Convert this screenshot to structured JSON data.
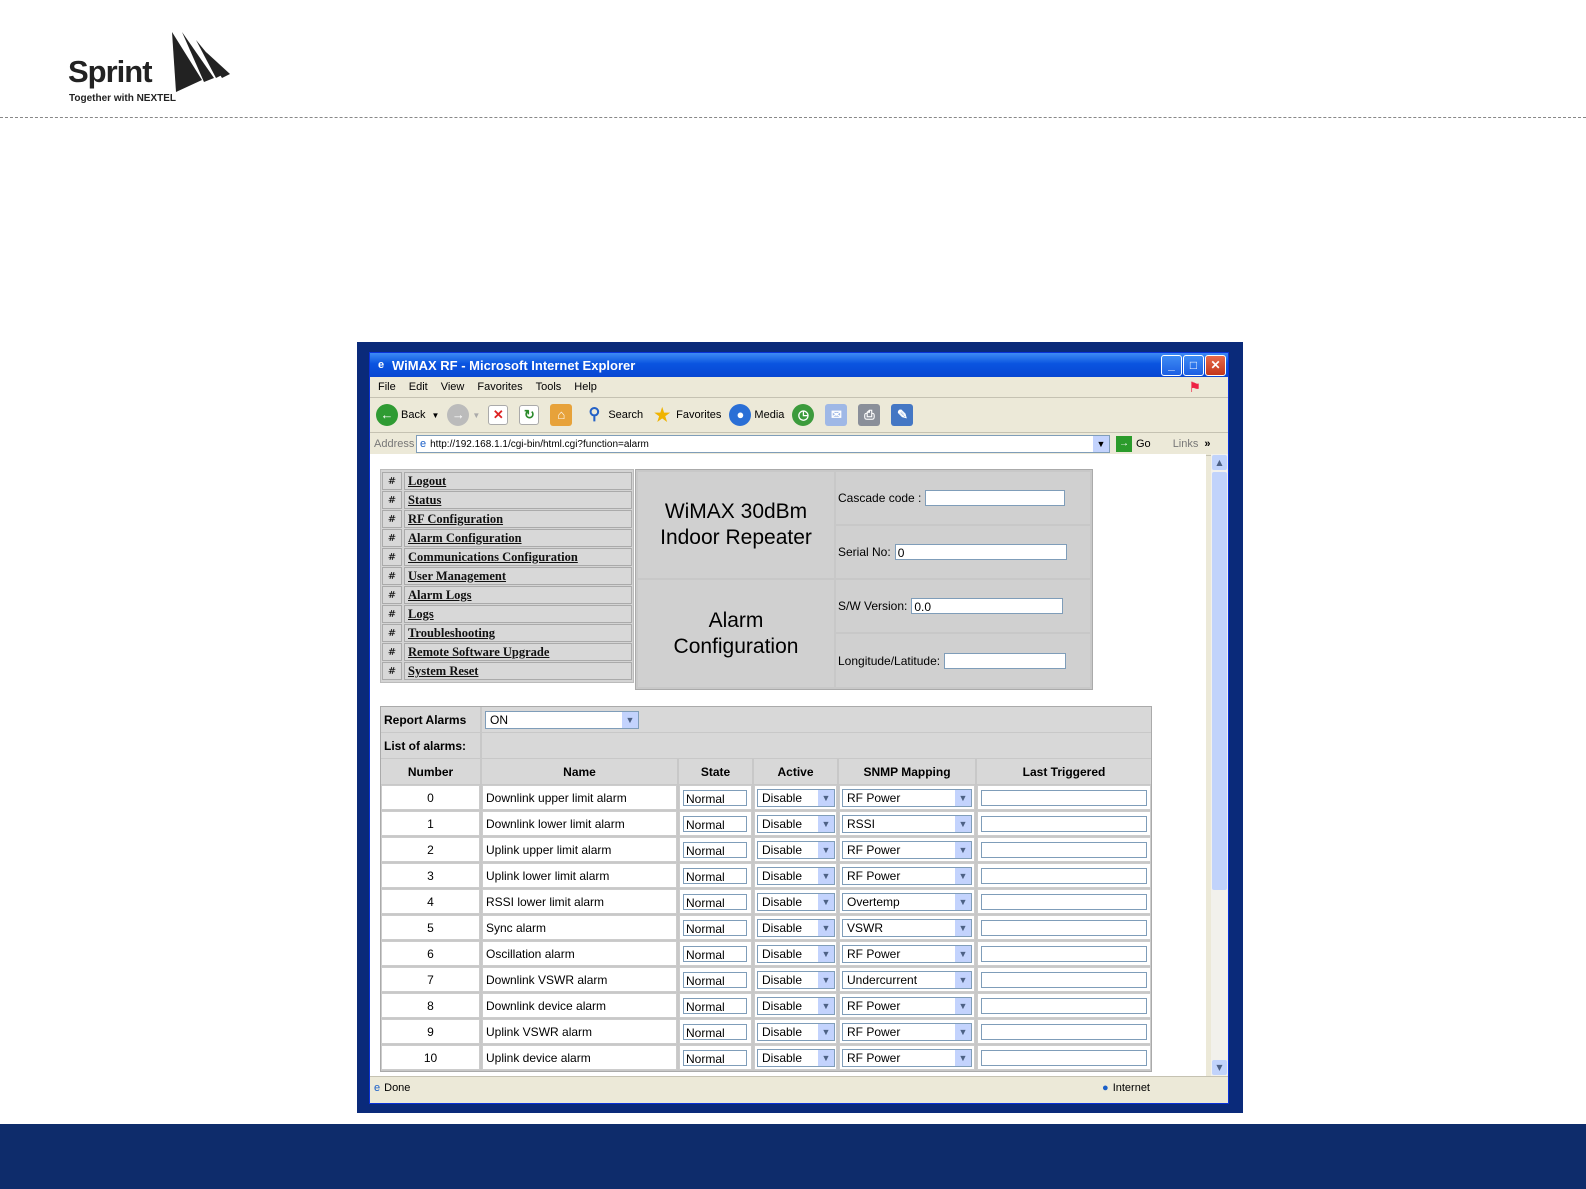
{
  "slide": {
    "logo_word": "Sprint",
    "logo_tagline": "Together with NEXTEL",
    "accent": "#0e2c6b"
  },
  "window": {
    "title": "WiMAX RF - Microsoft Internet Explorer",
    "menu": [
      "File",
      "Edit",
      "View",
      "Favorites",
      "Tools",
      "Help"
    ],
    "toolbar": {
      "back": "Back",
      "search": "Search",
      "favorites": "Favorites",
      "media": "Media"
    },
    "address_label": "Address",
    "address_url": "http://192.168.1.1/cgi-bin/html.cgi?function=alarm",
    "go_label": "Go",
    "links_label": "Links",
    "status_text": "Done",
    "status_zone": "Internet"
  },
  "nav": {
    "bullet": "#",
    "items": [
      "Logout",
      "Status",
      "RF Configuration",
      "Alarm Configuration",
      "Communications Configuration",
      "User Management",
      "Alarm Logs",
      "Logs",
      "Troubleshooting",
      "Remote Software Upgrade",
      "System Reset"
    ]
  },
  "header": {
    "product_line1": "WiMAX 30dBm",
    "product_line2": "Indoor Repeater",
    "page_line1": "Alarm",
    "page_line2": "Configuration",
    "cascade_label": "Cascade code :",
    "cascade_value": "",
    "serial_label": "Serial No:",
    "serial_value": "0",
    "sw_label": "S/W Version:",
    "sw_value": "0.0",
    "lonlat_label": "Longitude/Latitude:",
    "lonlat_value": ""
  },
  "alarms": {
    "report_label": "Report Alarms",
    "report_value": "ON",
    "list_label": "List of alarms:",
    "columns": [
      "Number",
      "Name",
      "State",
      "Active",
      "SNMP Mapping",
      "Last Triggered"
    ],
    "rows": [
      {
        "number": "0",
        "name": "Downlink upper limit alarm",
        "state": "Normal",
        "active": "Disable",
        "snmp": "RF Power",
        "last": ""
      },
      {
        "number": "1",
        "name": "Downlink lower limit alarm",
        "state": "Normal",
        "active": "Disable",
        "snmp": "RSSI",
        "last": ""
      },
      {
        "number": "2",
        "name": "Uplink upper limit alarm",
        "state": "Normal",
        "active": "Disable",
        "snmp": "RF Power",
        "last": ""
      },
      {
        "number": "3",
        "name": "Uplink lower limit alarm",
        "state": "Normal",
        "active": "Disable",
        "snmp": "RF Power",
        "last": ""
      },
      {
        "number": "4",
        "name": "RSSI lower limit alarm",
        "state": "Normal",
        "active": "Disable",
        "snmp": "Overtemp",
        "last": ""
      },
      {
        "number": "5",
        "name": "Sync alarm",
        "state": "Normal",
        "active": "Disable",
        "snmp": "VSWR",
        "last": ""
      },
      {
        "number": "6",
        "name": "Oscillation alarm",
        "state": "Normal",
        "active": "Disable",
        "snmp": "RF Power",
        "last": ""
      },
      {
        "number": "7",
        "name": "Downlink VSWR alarm",
        "state": "Normal",
        "active": "Disable",
        "snmp": "Undercurrent",
        "last": ""
      },
      {
        "number": "8",
        "name": "Downlink device alarm",
        "state": "Normal",
        "active": "Disable",
        "snmp": "RF Power",
        "last": ""
      },
      {
        "number": "9",
        "name": "Uplink VSWR alarm",
        "state": "Normal",
        "active": "Disable",
        "snmp": "RF Power",
        "last": ""
      },
      {
        "number": "10",
        "name": "Uplink device alarm",
        "state": "Normal",
        "active": "Disable",
        "snmp": "RF Power",
        "last": ""
      }
    ]
  }
}
